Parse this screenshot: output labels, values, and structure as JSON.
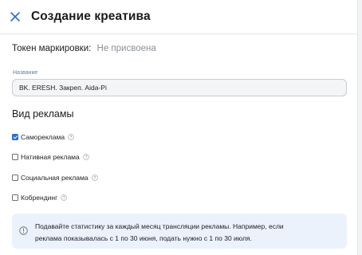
{
  "header": {
    "title": "Создание креатива",
    "close_icon": "close-icon"
  },
  "token": {
    "label": "Токен маркировки:",
    "value": "Не присвоена"
  },
  "name_field": {
    "caption": "Название",
    "value": "BK. ERESH. Закреп. Aida-Pi"
  },
  "ad_type": {
    "heading": "Вид рекламы",
    "options": [
      {
        "label": "Самореклама",
        "checked": true
      },
      {
        "label": "Нативная реклама",
        "checked": false
      },
      {
        "label": "Социальная реклама",
        "checked": false
      },
      {
        "label": "Кобрендинг",
        "checked": false
      }
    ]
  },
  "info": {
    "icon": "info-icon",
    "line1": "Подавайте статистику за каждый месяц трансляции рекламы. Например, если",
    "line2": "реклама показывалась с 1 по 30 июня, подать нужно с 1 по 30 июля."
  },
  "colors": {
    "accent": "#2a6fd6",
    "info_bg": "#ebf2fc",
    "muted": "#8a8f96"
  }
}
